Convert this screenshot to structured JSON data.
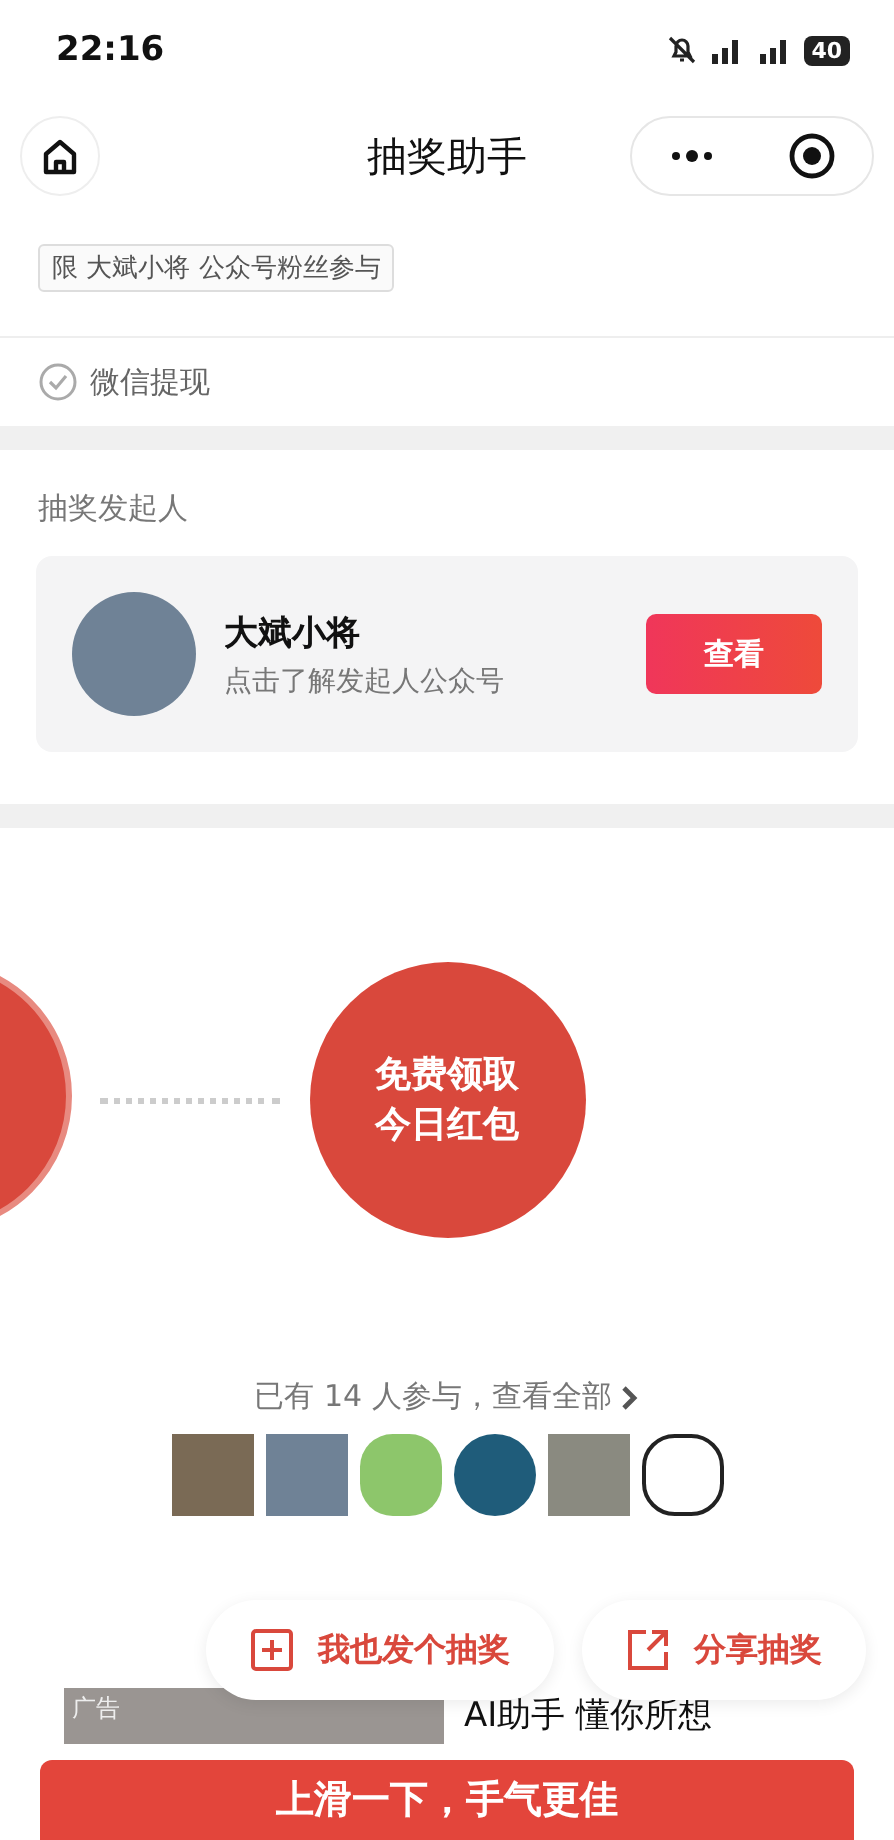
{
  "status_bar": {
    "time": "22:16",
    "battery": "40"
  },
  "nav": {
    "title": "抽奖助手"
  },
  "restriction_tag": "限 大斌小将 公众号粉丝参与",
  "withdraw": {
    "label": "微信提现",
    "checked": true
  },
  "organizer": {
    "section_title": "抽奖发起人",
    "name": "大斌小将",
    "subtitle": "点击了解发起人公众号",
    "button": "查看"
  },
  "lottery": {
    "button_lines": [
      "免费领取",
      "今日红包"
    ]
  },
  "participants": {
    "summary": "已有 14 人参与，查看全部"
  },
  "actions": [
    {
      "label": "我也发个抽奖",
      "kind": "create"
    },
    {
      "label": "分享抽奖",
      "kind": "share"
    }
  ],
  "ad": {
    "badge": "广告",
    "title": "AI助手 懂你所想"
  },
  "bottom_button": "上滑一下，手气更佳"
}
